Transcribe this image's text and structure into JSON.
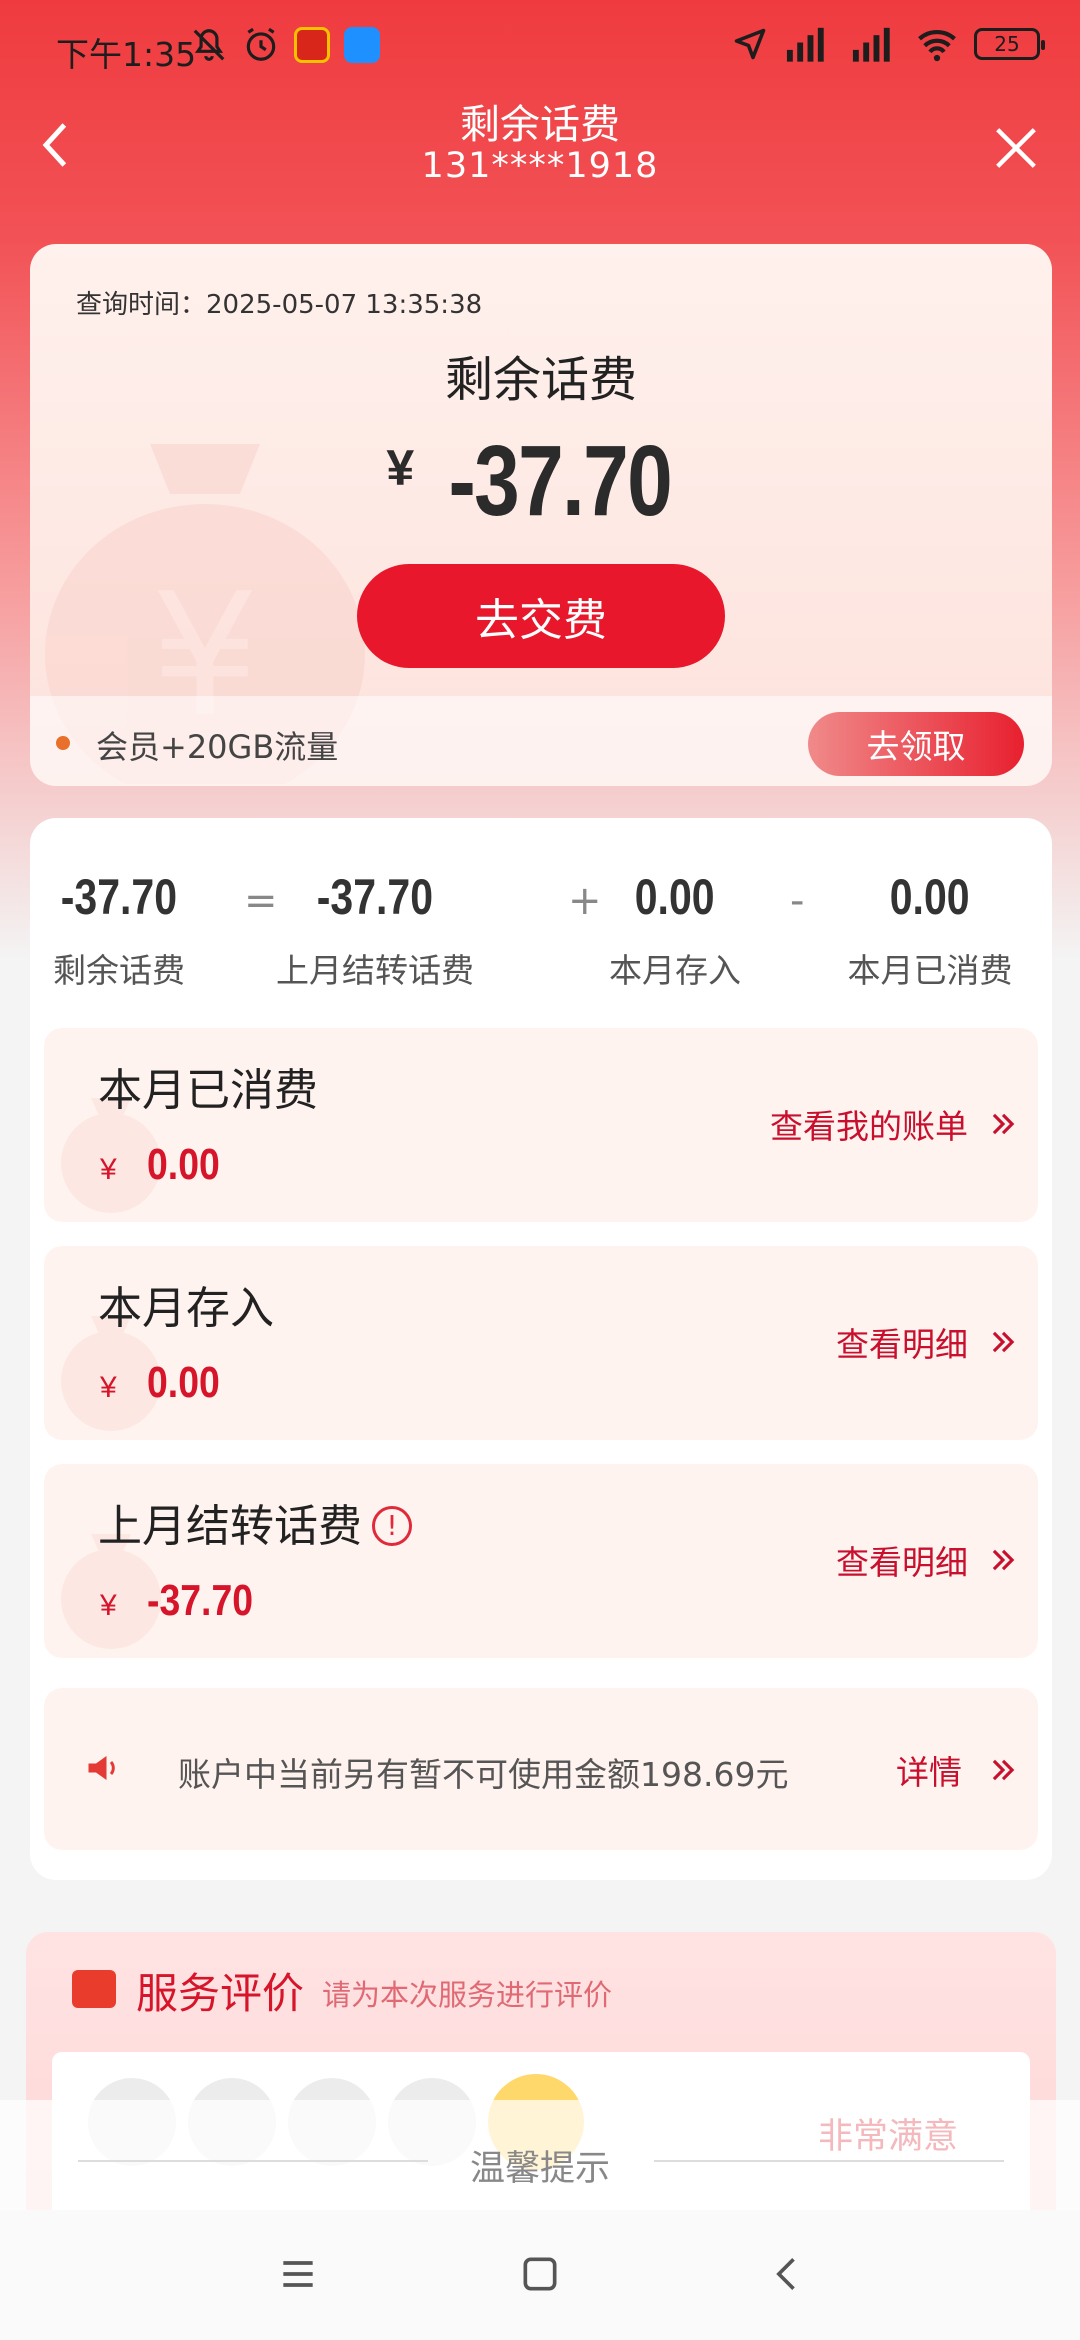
{
  "status_bar": {
    "time": "下午1:35",
    "battery": "25"
  },
  "nav": {
    "title": "剩余话费",
    "phone": "131****1918"
  },
  "hero": {
    "query_time_label": "查询时间：",
    "query_time": "2025-05-07 13:35:38",
    "title": "剩余话费",
    "currency": "¥",
    "amount": "-37.70",
    "pay_button": "去交费",
    "promo_text": "会员+20GB流量",
    "claim_button": "去领取"
  },
  "formula": {
    "items": [
      {
        "value": "-37.70",
        "label": "剩余话费"
      },
      {
        "value": "-37.70",
        "label": "上月结转话费"
      },
      {
        "value": "0.00",
        "label": "本月存入"
      },
      {
        "value": "0.00",
        "label": "本月已消费"
      }
    ],
    "ops": [
      "=",
      "+",
      "-"
    ]
  },
  "rows": [
    {
      "label": "本月已消费",
      "currency": "¥",
      "amount": "0.00",
      "link": "查看我的账单"
    },
    {
      "label": "本月存入",
      "currency": "¥",
      "amount": "0.00",
      "link": "查看明细"
    },
    {
      "label": "上月结转话费",
      "currency": "¥",
      "amount": "-37.70",
      "link": "查看明细"
    }
  ],
  "notice": {
    "text": "账户中当前另有暂不可使用金额198.69元",
    "link": "详情"
  },
  "service": {
    "title": "服务评价",
    "subtitle": "请为本次服务进行评价",
    "very_satisfied": "非常满意"
  },
  "tip": {
    "text": "温馨提示"
  },
  "colors": {
    "brand_red": "#e8172b",
    "link_red": "#c8102e"
  }
}
